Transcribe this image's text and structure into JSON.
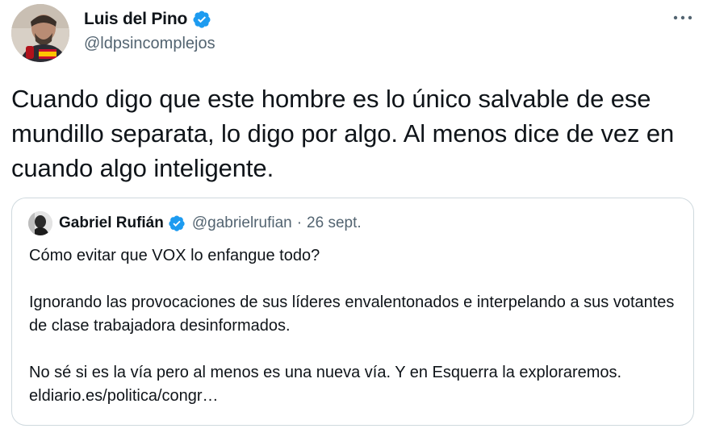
{
  "author": {
    "display_name": "Luis del Pino",
    "handle": "@ldpsincomplejos",
    "verified": true
  },
  "tweet": {
    "text": "Cuando digo que este hombre es lo único salvable de ese mundillo separata, lo digo por algo. Al menos dice de vez en cuando algo inteligente."
  },
  "more_icon": "ellipsis-icon",
  "quoted": {
    "display_name": "Gabriel Rufián",
    "handle": "@gabrielrufian",
    "separator": "·",
    "date": "26 sept.",
    "verified": true,
    "paragraphs": [
      "Cómo evitar que VOX lo enfangue todo?",
      "Ignorando las provocaciones de sus líderes envalentonados e interpelando a sus votantes de clase trabajadora desinformados.",
      "No sé si es la vía pero al menos es una nueva vía. Y en Esquerra la exploraremos.",
      "eldiario.es/politica/congr…"
    ]
  },
  "colors": {
    "verified_blue": "#1d9bf0",
    "text_primary": "#0f1419",
    "text_secondary": "#536471",
    "border": "#cfd9de"
  }
}
